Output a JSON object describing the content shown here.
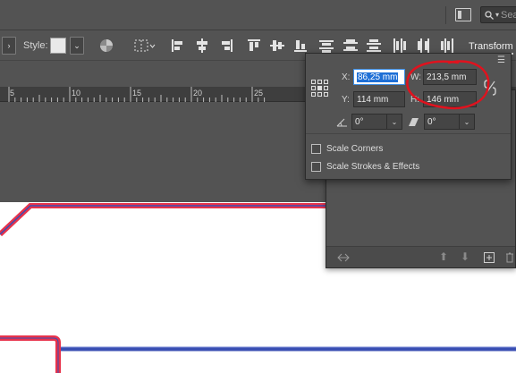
{
  "appbar": {
    "search_placeholder": "Sea",
    "icons": [
      "panels-icon",
      "search-icon"
    ]
  },
  "controlbar": {
    "style_label": "Style:",
    "transform_tab": "Transform",
    "icons": [
      "chevron-right-icon",
      "style-swatch",
      "chevron-down-icon",
      "color-wheel-icon",
      "distribute-grid-icon",
      "align-left-edges-icon",
      "align-horizontal-centers-icon",
      "align-right-edges-icon",
      "align-top-edges-icon",
      "align-vertical-centers-icon",
      "align-bottom-edges-icon",
      "distribute-top-icon",
      "distribute-vertical-centers-icon",
      "distribute-bottom-icon",
      "distribute-left-icon",
      "distribute-horizontal-centers-icon",
      "distribute-right-icon"
    ]
  },
  "ruler": {
    "ticks": [
      "5",
      "10",
      "15",
      "20",
      "25"
    ]
  },
  "transform": {
    "x_label": "X:",
    "x_value": "86,25 mm",
    "y_label": "Y:",
    "y_value": "114 mm",
    "w_label": "W:",
    "w_value": "213,5 mm",
    "h_label": "H:",
    "h_value": "146 mm",
    "rotation_value": "0°",
    "shear_value": "0°",
    "scale_corners_label": "Scale Corners",
    "scale_strokes_label": "Scale Strokes & Effects",
    "scale_corners_checked": false,
    "scale_strokes_checked": false
  },
  "colors": {
    "ui_bg": "#535353",
    "frame_red": "#e8334b",
    "frame_blue": "#3a4fb3",
    "annotation_red": "#e0121e",
    "selection_blue": "#1e6fd6"
  }
}
